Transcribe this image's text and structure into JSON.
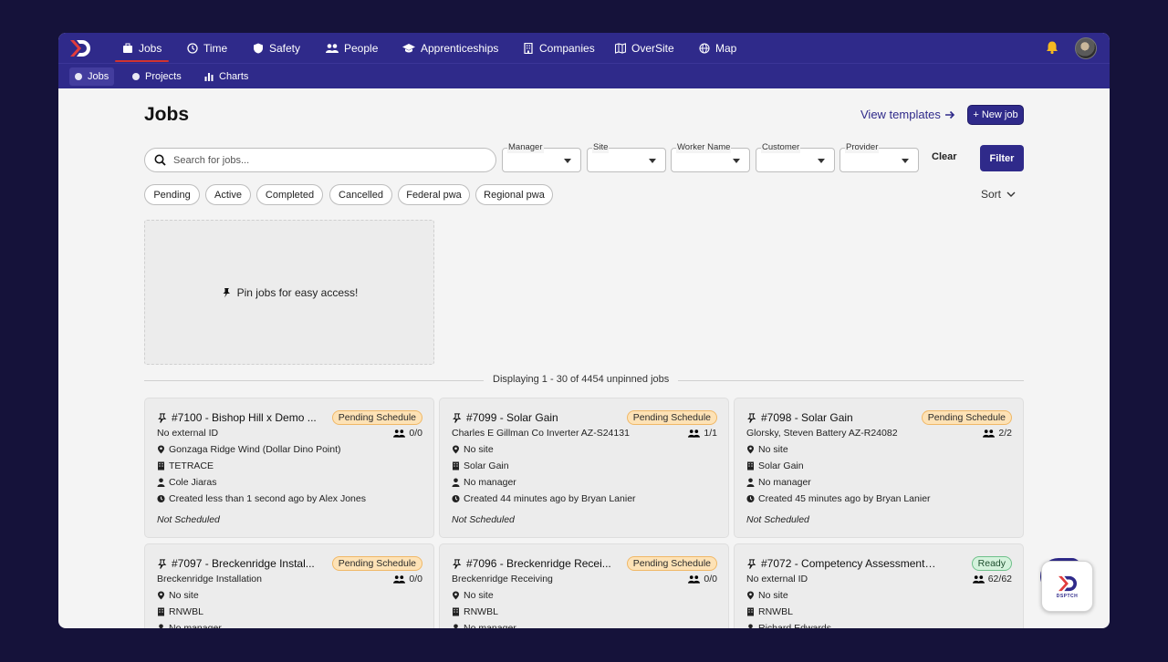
{
  "nav": {
    "items": [
      {
        "label": "Jobs",
        "icon": "briefcase-icon",
        "active": true
      },
      {
        "label": "Time",
        "icon": "clock-icon"
      },
      {
        "label": "Safety",
        "icon": "shield-icon"
      },
      {
        "label": "People",
        "icon": "people-icon"
      },
      {
        "label": "Apprenticeships",
        "icon": "graduation-cap-icon"
      },
      {
        "label": "Companies",
        "icon": "building-icon"
      },
      {
        "label": "OverSite",
        "icon": "map-book-icon"
      },
      {
        "label": "Map",
        "icon": "globe-icon"
      }
    ]
  },
  "subnav": {
    "items": [
      {
        "label": "Jobs",
        "active": true
      },
      {
        "label": "Projects"
      },
      {
        "label": "Charts"
      }
    ]
  },
  "page": {
    "title": "Jobs",
    "view_templates": "View templates",
    "new_job": "+ New job",
    "search_placeholder": "Search for jobs...",
    "selects": [
      "Manager",
      "Site",
      "Worker Name",
      "Customer",
      "Provider"
    ],
    "clear": "Clear",
    "filter": "Filter",
    "chips": [
      "Pending",
      "Active",
      "Completed",
      "Cancelled",
      "Federal pwa",
      "Regional pwa"
    ],
    "sort": "Sort",
    "pin_message": "Pin jobs for easy access!",
    "displaying": "Displaying 1 - 30 of 4454 unpinned jobs"
  },
  "cards": [
    {
      "title": "#7100 - Bishop Hill x Demo ...",
      "badge": "Pending Schedule",
      "sub": "No external ID",
      "workers": "0/0",
      "site": "Gonzaga Ridge Wind (Dollar Dino Point)",
      "company": "TETRACE",
      "manager": "Cole Jiaras",
      "created": "Created less than 1 second ago by Alex Jones",
      "schedule": "Not Scheduled"
    },
    {
      "title": "#7099 - Solar Gain",
      "badge": "Pending Schedule",
      "sub": "Charles E Gillman Co Inverter AZ-S24131",
      "workers": "1/1",
      "site": "No site",
      "company": "Solar Gain",
      "manager": "No manager",
      "created": "Created 44 minutes ago by Bryan Lanier",
      "schedule": "Not Scheduled"
    },
    {
      "title": "#7098 - Solar Gain",
      "badge": "Pending Schedule",
      "sub": "Glorsky, Steven Battery AZ-R24082",
      "workers": "2/2",
      "site": "No site",
      "company": "Solar Gain",
      "manager": "No manager",
      "created": "Created 45 minutes ago by Bryan Lanier",
      "schedule": "Not Scheduled"
    },
    {
      "title": "#7097 - Breckenridge Instal...",
      "badge": "Pending Schedule",
      "sub": "Breckenridge Installation",
      "workers": "0/0",
      "site": "No site",
      "company": "RNWBL",
      "manager": "No manager",
      "created": "",
      "schedule": ""
    },
    {
      "title": "#7096 - Breckenridge Recei...",
      "badge": "Pending Schedule",
      "sub": "Breckenridge Receiving",
      "workers": "0/0",
      "site": "No site",
      "company": "RNWBL",
      "manager": "No manager",
      "created": "",
      "schedule": ""
    },
    {
      "title": "#7072 - Competency Assessment Pro...",
      "badge": "Ready",
      "sub": "No external ID",
      "workers": "62/62",
      "site": "No site",
      "company": "RNWBL",
      "manager": "Richard Edwards",
      "created": "",
      "schedule": ""
    }
  ],
  "fab": {
    "word": "DSPTCH"
  },
  "colors": {
    "brand": "#2f2a8a",
    "accent_red": "#d0332f",
    "pending_badge": "#fde2b6",
    "ready_badge": "#d4f2dc"
  }
}
